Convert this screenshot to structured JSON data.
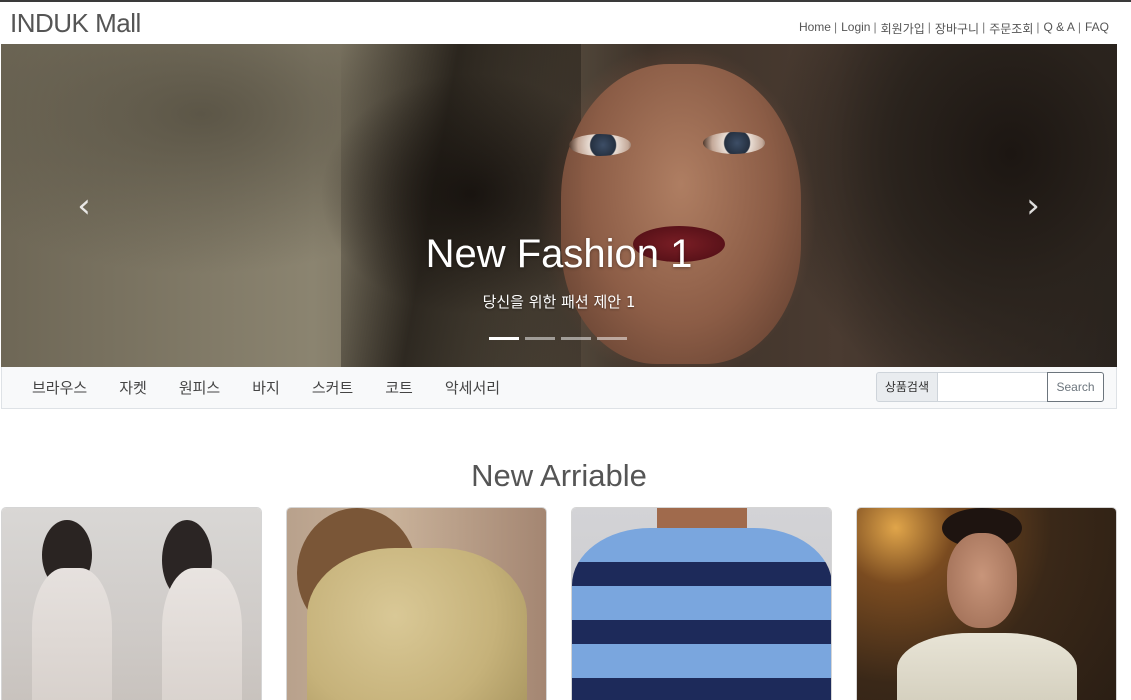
{
  "brand": "INDUK Mall",
  "util_nav": [
    "Home",
    "Login",
    "회원가입",
    "장바구니",
    "주문조회",
    "Q & A",
    "FAQ"
  ],
  "carousel": {
    "title": "New Fashion 1",
    "subtitle": "당신을 위한 패션 제안 1",
    "prev_icon": "chevron-left-icon",
    "next_icon": "chevron-right-icon",
    "slide_count": 4,
    "active_index": 0
  },
  "categories": [
    "브라우스",
    "자켓",
    "원피스",
    "바지",
    "스커트",
    "코트",
    "악세서리"
  ],
  "search": {
    "label": "상품검색",
    "placeholder": "",
    "button": "Search"
  },
  "section": {
    "title": "New Arriable"
  }
}
